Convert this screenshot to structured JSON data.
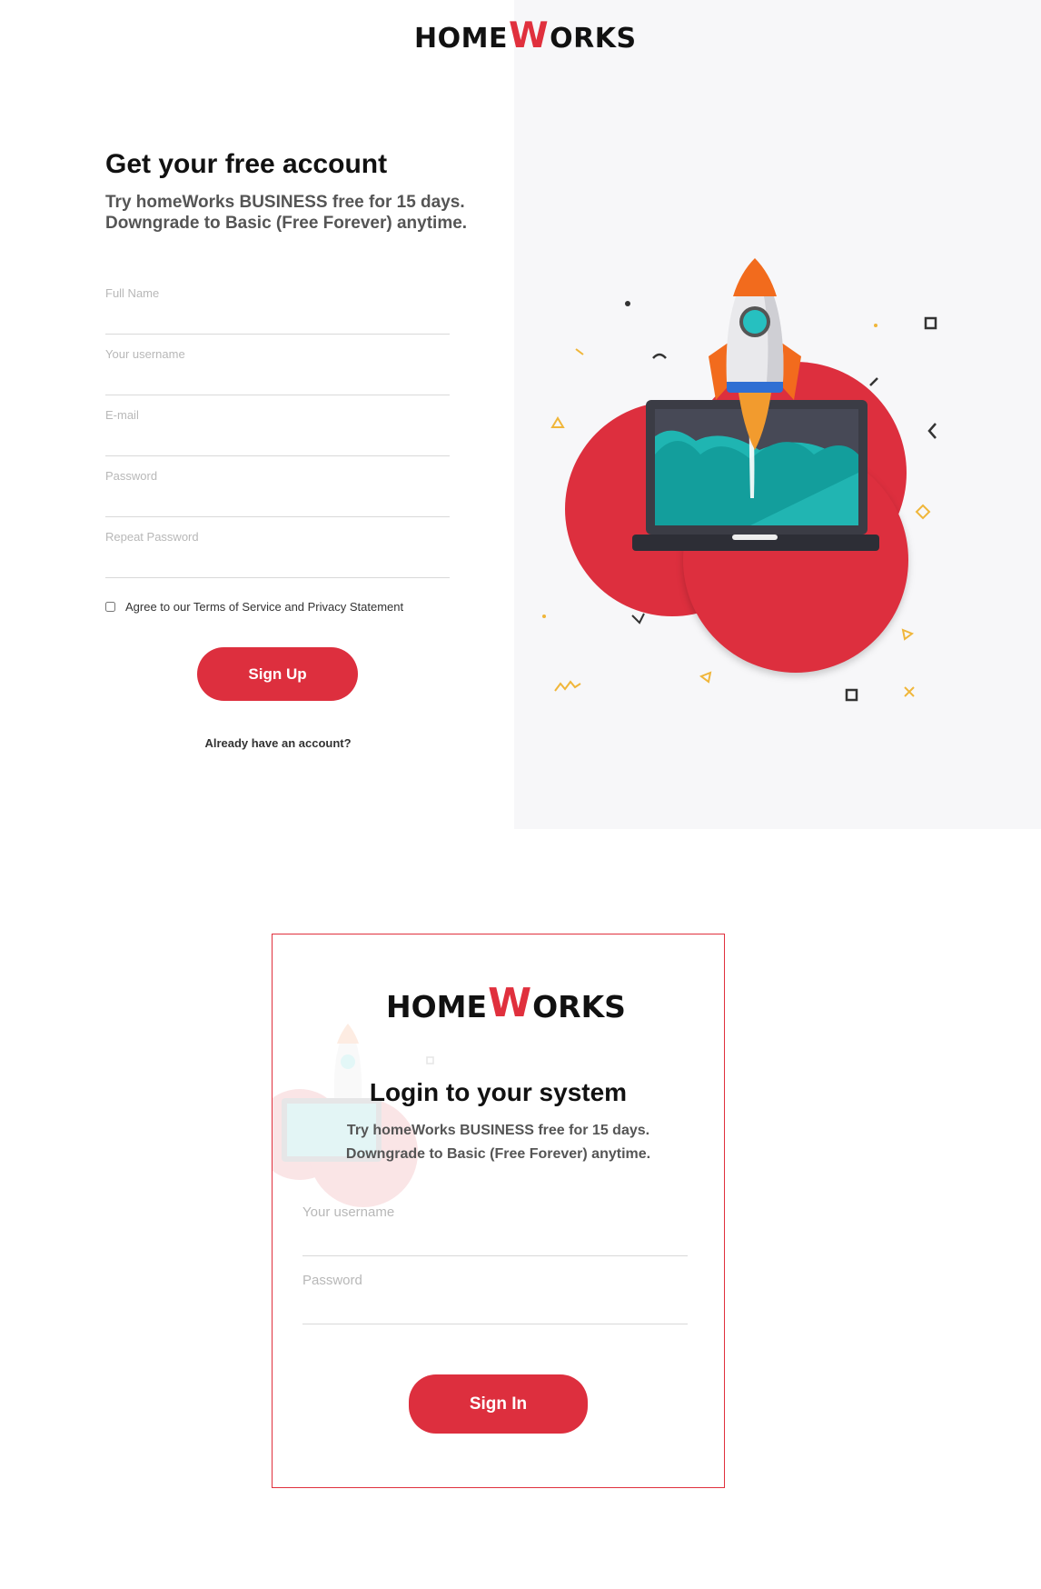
{
  "brand": {
    "logo_prefix": "HOME",
    "logo_w": "W",
    "logo_suffix": "ORKS",
    "accent": "#dd2f3e"
  },
  "signup": {
    "title": "Get your free account",
    "subtitle_line1": "Try homeWorks BUSINESS free for 15 days.",
    "subtitle_line2": "Downgrade to Basic (Free Forever) anytime.",
    "fields": {
      "full_name": {
        "placeholder": "Full Name",
        "value": ""
      },
      "username": {
        "placeholder": "Your username",
        "value": ""
      },
      "email": {
        "placeholder": "E-mail",
        "value": ""
      },
      "password": {
        "placeholder": "Password",
        "value": ""
      },
      "repeat_password": {
        "placeholder": "Repeat Password",
        "value": ""
      }
    },
    "agree_label": "Agree to our Terms of Service and Privacy Statement",
    "agree_checked": false,
    "submit_label": "Sign Up",
    "already_link": "Already have an account?"
  },
  "illustration": {
    "name": "rocket-launch-laptop-illustration"
  },
  "login": {
    "title": "Login to your system",
    "subtitle_line1": "Try homeWorks BUSINESS free for 15 days.",
    "subtitle_line2": "Downgrade to Basic (Free Forever) anytime.",
    "fields": {
      "username": {
        "placeholder": "Your username",
        "value": ""
      },
      "password": {
        "placeholder": "Password",
        "value": ""
      }
    },
    "submit_label": "Sign In"
  }
}
